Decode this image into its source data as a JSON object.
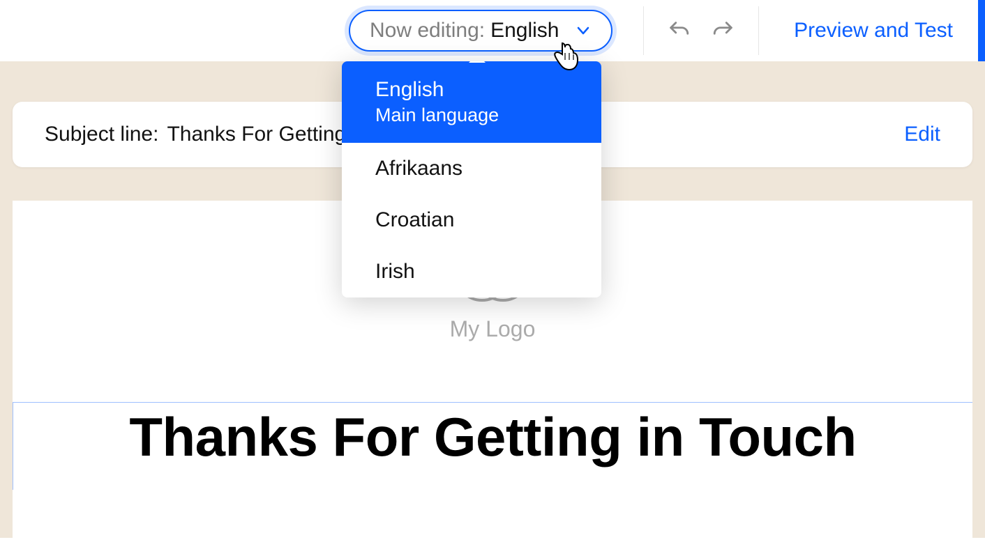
{
  "toolbar": {
    "language_pill": {
      "prefix": "Now editing:",
      "current": "English"
    },
    "preview_label": "Preview and Test"
  },
  "dropdown": {
    "items": [
      {
        "label": "English",
        "sublabel": "Main language",
        "selected": true
      },
      {
        "label": "Afrikaans",
        "selected": false
      },
      {
        "label": "Croatian",
        "selected": false
      },
      {
        "label": "Irish",
        "selected": false
      }
    ]
  },
  "subject": {
    "label": "Subject line:",
    "value": "Thanks For Getting in Touch",
    "edit_label": "Edit"
  },
  "email": {
    "logo_text": "My Logo",
    "headline": "Thanks For Getting in Touch"
  },
  "colors": {
    "accent": "#0b5fff",
    "canvas_bg": "#efe6d9"
  }
}
